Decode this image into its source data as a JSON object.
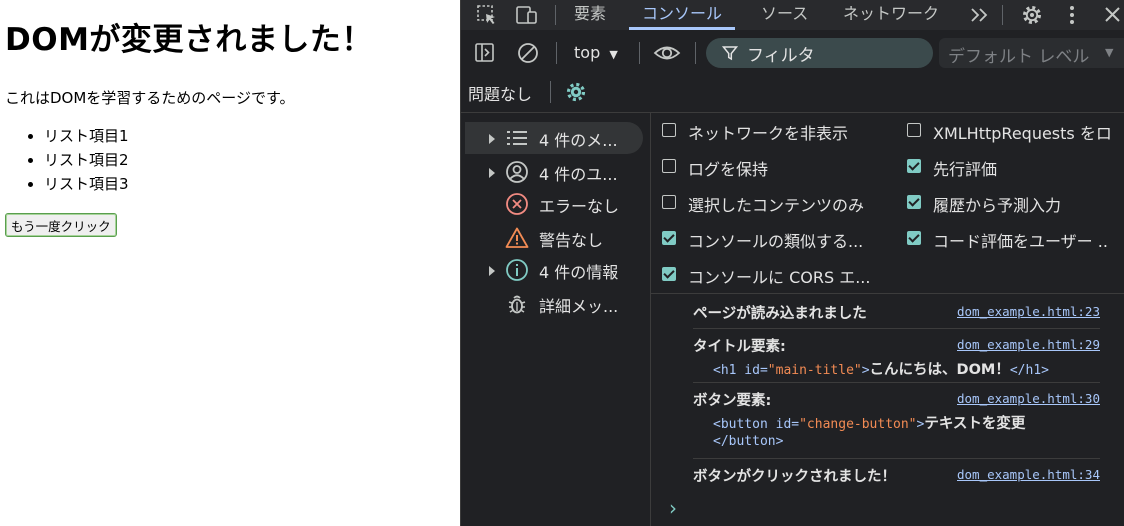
{
  "page": {
    "title": "DOMが変更されました！",
    "paragraph": "これはDOMを学習するためのページです。",
    "list_items": [
      "リスト項目1",
      "リスト項目2",
      "リスト項目3"
    ],
    "button_label": "もう一度クリック"
  },
  "devtools": {
    "tabs": [
      "要素",
      "コンソール",
      "ソース",
      "ネットワーク"
    ],
    "active_tab": "コンソール",
    "toolbar": {
      "context": "top",
      "filter_placeholder": "フィルタ",
      "level": "デフォルト レベル"
    },
    "issues_label": "問題なし",
    "sidebar": [
      {
        "label": "4 件のメ...",
        "icon": "list-icon",
        "expandable": true,
        "selected": true
      },
      {
        "label": "4 件のユ...",
        "icon": "user-icon",
        "expandable": true,
        "selected": false
      },
      {
        "label": "エラーなし",
        "icon": "error-icon",
        "expandable": false,
        "selected": false
      },
      {
        "label": "警告なし",
        "icon": "warning-icon",
        "expandable": false,
        "selected": false
      },
      {
        "label": "4 件の情報",
        "icon": "info-icon",
        "expandable": true,
        "selected": false
      },
      {
        "label": "詳細メッ...",
        "icon": "bug-icon",
        "expandable": false,
        "selected": false
      }
    ],
    "settings": [
      {
        "label": "ネットワークを非表示",
        "checked": false
      },
      {
        "label": "XMLHttpRequests をロ",
        "checked": false
      },
      {
        "label": "ログを保持",
        "checked": false
      },
      {
        "label": "先行評価",
        "checked": true
      },
      {
        "label": "選択したコンテンツのみ",
        "checked": false
      },
      {
        "label": "履歴から予測入力",
        "checked": true
      },
      {
        "label": "コンソールの類似する...",
        "checked": true
      },
      {
        "label": "コード評価をユーザー ..",
        "checked": true
      },
      {
        "label": "コンソールに CORS エ...",
        "checked": true
      }
    ],
    "messages": [
      {
        "text": "ページが読み込まれました",
        "source": "dom_example.html:23"
      },
      {
        "text": "タイトル要素:",
        "source": "dom_example.html:29",
        "code": {
          "open": "<h1",
          "attr": " id=",
          "value": "\"main-title\"",
          "close": ">",
          "content": "こんにちは、DOM！",
          "end": "</h1>"
        }
      },
      {
        "text": "ボタン要素:",
        "source": "dom_example.html:30",
        "code": {
          "open": "<button",
          "attr": " id=",
          "value": "\"change-button\"",
          "close": ">",
          "content": "テキストを変更",
          "end": "</button>"
        }
      },
      {
        "text": "ボタンがクリックされました！",
        "source": "dom_example.html:34"
      }
    ],
    "prompt": "›"
  },
  "colors": {
    "devtools_bg": "#202124",
    "accent": "#a8c7fa",
    "checkbox": "#80cbc4",
    "attr_value": "#f28b54"
  }
}
